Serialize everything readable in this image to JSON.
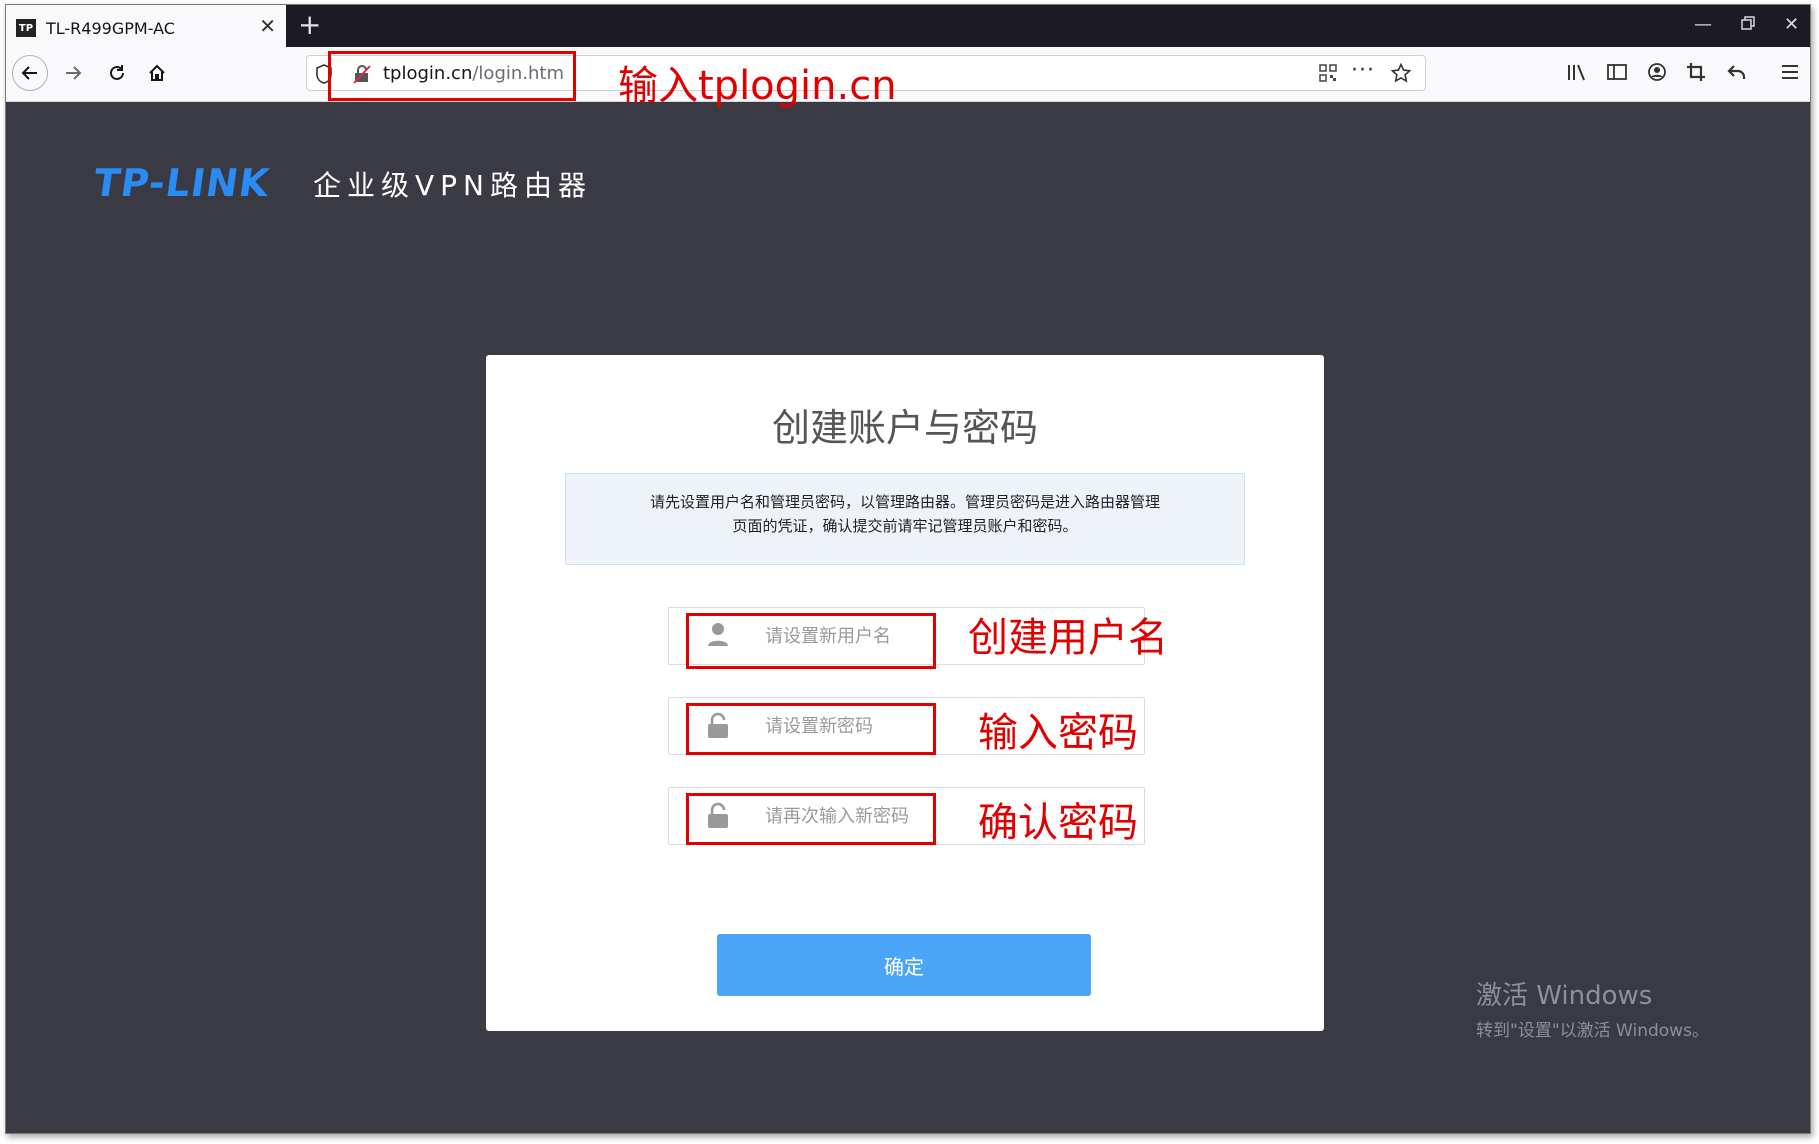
{
  "browser": {
    "tab_title": "TL-R499GPM-AC",
    "tab_favicon": "TP",
    "url_host": "tplogin.cn",
    "url_path": "/login.htm"
  },
  "page": {
    "brand": "TP-LINK",
    "product": "企业级VPN路由器",
    "card_title": "创建账户与密码",
    "notice_line1": "请先设置用户名和管理员密码，以管理路由器。管理员密码是进入路由器管理",
    "notice_line2": "页面的凭证，确认提交前请牢记管理员账户和密码。",
    "username_placeholder": "请设置新用户名",
    "password_placeholder": "请设置新密码",
    "confirm_placeholder": "请再次输入新密码",
    "confirm_button": "确定"
  },
  "annotations": {
    "url": "输入tplogin.cn",
    "username": "创建用户名",
    "password": "输入密码",
    "confirm": "确认密码"
  },
  "watermark": {
    "title": "激活 Windows",
    "subtitle": "转到\"设置\"以激活 Windows。"
  },
  "colors": {
    "page_bg": "#3a3a45",
    "brand_blue": "#2a8bf2",
    "button_blue": "#4aa5f7",
    "annotation_red": "#e10000"
  }
}
